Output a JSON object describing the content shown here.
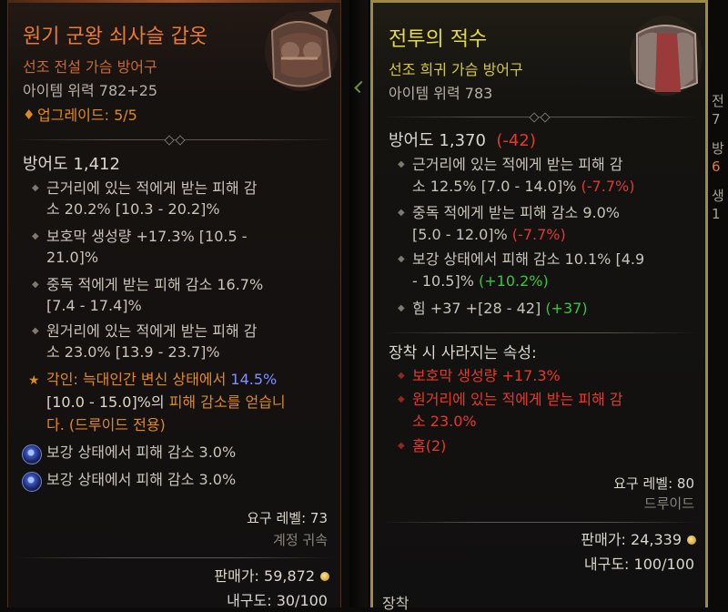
{
  "left_item": {
    "name": "원기 군왕 쇠사슬 갑옷",
    "type": "선조 전설 가슴 방어구",
    "item_power": "아이템 위력 782+25",
    "upgrade": "업그레이드: 5/5",
    "armor": "방어도 1,412",
    "affixes": [
      {
        "line1": "근거리에 있는 적에게 받는 피해 감",
        "line2": "소 20.2% [10.3 - 20.2]%"
      },
      {
        "line1": "보호막 생성량 +17.3% [10.5 -",
        "line2": "21.0]%"
      },
      {
        "line1": "중독 적에게 받는 피해 감소 16.7%",
        "line2": "[7.4 - 17.4]%"
      },
      {
        "line1": "원거리에 있는 적에게 받는 피해 감",
        "line2": "소 23.0% [13.9 - 23.7]%"
      }
    ],
    "aspect": {
      "prefix": "각인: ",
      "text1": "늑대인간 변신 상태에서 ",
      "value": "14.5%",
      "range": "[10.0 - 15.0]%의 ",
      "text2": "피해 감소를 얻습니",
      "text3": "다. (드루이드 전용)"
    },
    "sockets": [
      "보강 상태에서 피해 감소 3.0%",
      "보강 상태에서 피해 감소 3.0%"
    ],
    "required_level": "요구 레벨: 73",
    "account_bound": "계정 귀속",
    "sell_value": "판매가: 59,872",
    "durability": "내구도: 30/100"
  },
  "right_item": {
    "name": "전투의 적수",
    "type": "선조 희귀 가슴 방어구",
    "item_power": "아이템 위력 783",
    "armor": "방어도 1,370",
    "armor_diff": "(-42)",
    "affixes": [
      {
        "line1": "근거리에 있는 적에게 받는 피해 감",
        "line2": "소 12.5% [7.0 - 14.0]%",
        "diff": "(-7.7%)",
        "diff_color": "red"
      },
      {
        "line1": "중독 적에게 받는 피해 감소 9.0%",
        "line2": "[5.0 - 12.0]%",
        "diff": "(-7.7%)",
        "diff_color": "red"
      },
      {
        "line1": "보강 상태에서 피해 감소 10.1% [4.9",
        "line2": "- 10.5]%",
        "diff": "(+10.2%)",
        "diff_color": "green"
      },
      {
        "line1": "힘 +37 +[28 - 42]",
        "line2": "",
        "diff": "(+37)",
        "diff_color": "green"
      }
    ],
    "lost_header": "장착 시 사라지는 속성:",
    "lost": [
      "보호막 생성량 +17.3%",
      "원거리에 있는 적에게 받는 피해 감",
      "소 23.0%",
      "홈(2)"
    ],
    "required_level": "요구 레벨: 80",
    "class": "드루이드",
    "sell_value": "판매가: 24,339",
    "durability": "내구도: 100/100"
  },
  "bottom_partial": "장착",
  "right_edge_chars": [
    "전",
    "7",
    "방",
    "6",
    "생",
    "1"
  ],
  "colors": {
    "legendary": "#e97b32",
    "rare": "#e6dc3c",
    "aspect_orange": "#e07d22",
    "negative": "#e23a2a",
    "positive": "#3ec43e",
    "socket_blue": "#8090ff"
  }
}
